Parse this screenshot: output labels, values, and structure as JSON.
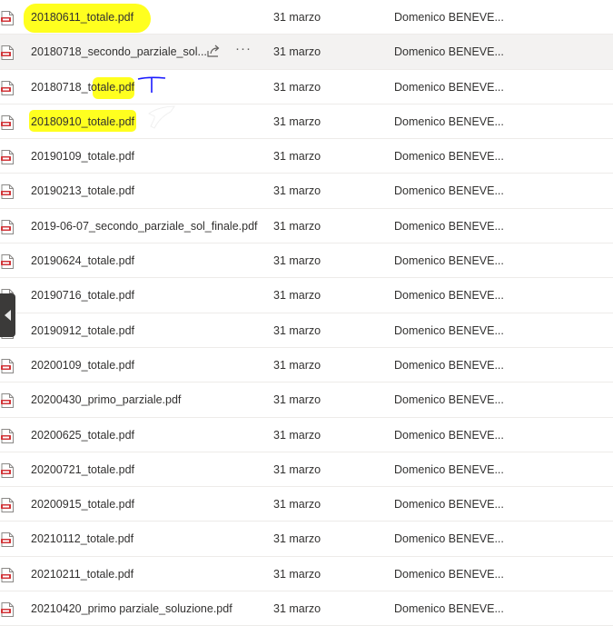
{
  "files": [
    {
      "name": "20180611_totale.pdf",
      "date": "31 marzo",
      "author": "Domenico BENEVE..."
    },
    {
      "name": "20180718_secondo_parziale_sol...",
      "date": "31 marzo",
      "author": "Domenico BENEVE..."
    },
    {
      "name": "20180718_totale.pdf",
      "date": "31 marzo",
      "author": "Domenico BENEVE..."
    },
    {
      "name": "20180910_totale.pdf",
      "date": "31 marzo",
      "author": "Domenico BENEVE..."
    },
    {
      "name": "20190109_totale.pdf",
      "date": "31 marzo",
      "author": "Domenico BENEVE..."
    },
    {
      "name": "20190213_totale.pdf",
      "date": "31 marzo",
      "author": "Domenico BENEVE..."
    },
    {
      "name": "2019-06-07_secondo_parziale_sol_finale.pdf",
      "date": "31 marzo",
      "author": "Domenico BENEVE..."
    },
    {
      "name": "20190624_totale.pdf",
      "date": "31 marzo",
      "author": "Domenico BENEVE..."
    },
    {
      "name": "20190716_totale.pdf",
      "date": "31 marzo",
      "author": "Domenico BENEVE..."
    },
    {
      "name": "20190912_totale.pdf",
      "date": "31 marzo",
      "author": "Domenico BENEVE..."
    },
    {
      "name": "20200109_totale.pdf",
      "date": "31 marzo",
      "author": "Domenico BENEVE..."
    },
    {
      "name": "20200430_primo_parziale.pdf",
      "date": "31 marzo",
      "author": "Domenico BENEVE..."
    },
    {
      "name": "20200625_totale.pdf",
      "date": "31 marzo",
      "author": "Domenico BENEVE..."
    },
    {
      "name": "20200721_totale.pdf",
      "date": "31 marzo",
      "author": "Domenico BENEVE..."
    },
    {
      "name": "20200915_totale.pdf",
      "date": "31 marzo",
      "author": "Domenico BENEVE..."
    },
    {
      "name": "20210112_totale.pdf",
      "date": "31 marzo",
      "author": "Domenico BENEVE..."
    },
    {
      "name": "20210211_totale.pdf",
      "date": "31 marzo",
      "author": "Domenico BENEVE..."
    },
    {
      "name": "20210420_primo parziale_soluzione.pdf",
      "date": "31 marzo",
      "author": "Domenico BENEVE..."
    }
  ],
  "hovered_row": 1,
  "row_actions": {
    "share_icon": "share-icon",
    "more_icon": "more-options-icon",
    "more_glyph": "···"
  },
  "file_icon": "pdf-file-icon",
  "highlights": [
    {
      "row": 0,
      "color": "#ffff1f"
    },
    {
      "row": 2,
      "color": "#ffff1f"
    },
    {
      "row": 3,
      "color": "#ffff1f"
    }
  ],
  "annotation_color": "#1a1aff",
  "side_toggle_icon": "chevron-left-icon"
}
